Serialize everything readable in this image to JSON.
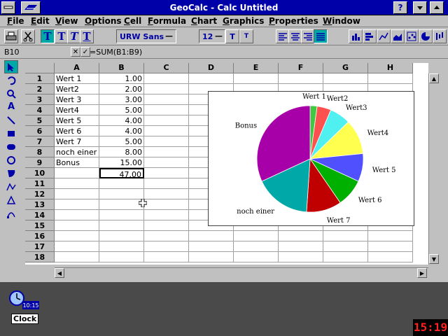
{
  "window": {
    "title": "GeoCalc - Calc Untitled"
  },
  "menu": [
    "File",
    "Edit",
    "View",
    "Options",
    "Cell",
    "Formula",
    "Chart",
    "Graphics",
    "Properties",
    "Window"
  ],
  "toolbar": {
    "font_name": "URW Sans",
    "font_size": "12"
  },
  "formula_bar": {
    "cell_ref": "B10",
    "formula": "=SUM(B1:B9)"
  },
  "grid": {
    "columns": [
      "A",
      "B",
      "C",
      "D",
      "E",
      "F",
      "G",
      "H"
    ],
    "rows": [
      "1",
      "2",
      "3",
      "4",
      "5",
      "6",
      "7",
      "8",
      "9",
      "10",
      "11",
      "12",
      "13",
      "14",
      "15",
      "16",
      "17",
      "18"
    ],
    "cells": [
      {
        "a": "Wert 1",
        "b": "1.00"
      },
      {
        "a": "Wert2",
        "b": "2.00"
      },
      {
        "a": "Wert 3",
        "b": "3.00"
      },
      {
        "a": "Wert4",
        "b": "5.00"
      },
      {
        "a": "Wert 5",
        "b": "4.00"
      },
      {
        "a": "Wert 6",
        "b": "4.00"
      },
      {
        "a": "Wert 7",
        "b": "5.00"
      },
      {
        "a": "noch einer",
        "b": "8.00"
      },
      {
        "a": "Bonus",
        "b": "15.00"
      },
      {
        "a": "",
        "b": "47.00"
      }
    ]
  },
  "chart_data": {
    "type": "pie",
    "categories": [
      "Wert 1",
      "Wert2",
      "Wert3",
      "Wert4",
      "Wert 5",
      "Wert 6",
      "Wert 7",
      "noch einer",
      "Bonus"
    ],
    "values": [
      1,
      2,
      3,
      5,
      4,
      4,
      5,
      8,
      15
    ],
    "colors": [
      "#40c840",
      "#ff5050",
      "#50f0f0",
      "#ffff50",
      "#5050ff",
      "#00b000",
      "#c00000",
      "#00a8a8",
      "#a800a8"
    ]
  },
  "desktop": {
    "clock_label": "Clock",
    "clock_time": "10:15",
    "time": "15:19"
  }
}
